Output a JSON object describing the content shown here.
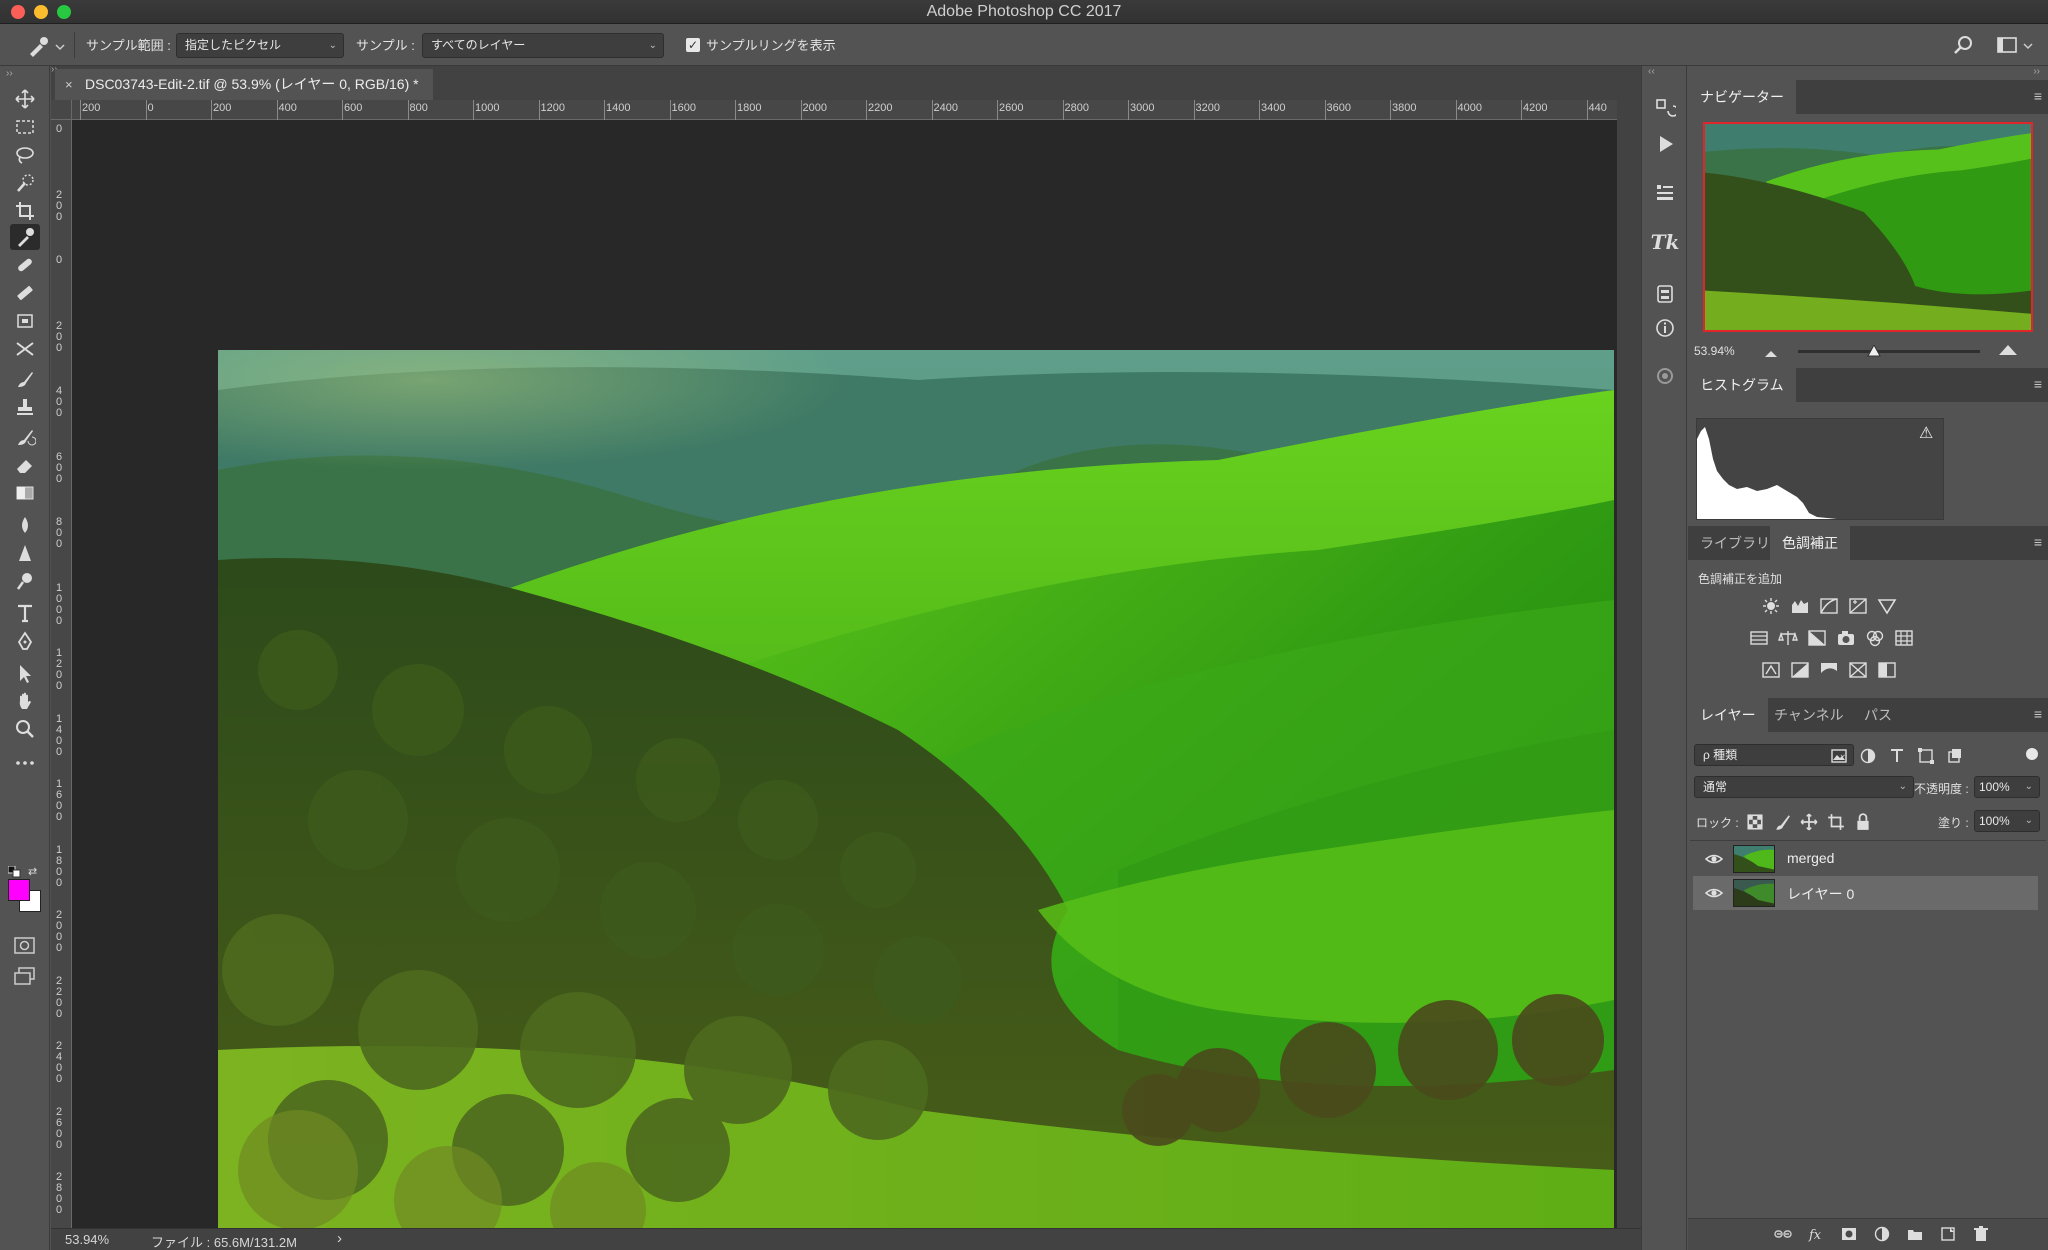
{
  "window": {
    "title": "Adobe Photoshop CC 2017"
  },
  "options": {
    "sample_size_label": "サンプル範囲 :",
    "sample_size_value": "指定したピクセル",
    "sample_label": "サンプル :",
    "sample_value": "すべてのレイヤー",
    "show_ring_label": "サンプルリングを表示",
    "show_ring_checked": true
  },
  "document": {
    "tab_title": "DSC03743-Edit-2.tif @ 53.9% (レイヤー 0, RGB/16) *",
    "close_glyph": "×",
    "ruler_h": [
      "200",
      "0",
      "200",
      "400",
      "600",
      "800",
      "1000",
      "1200",
      "1400",
      "1600",
      "1800",
      "2000",
      "2200",
      "2400",
      "2600",
      "2800",
      "3000",
      "3200",
      "3400",
      "3600",
      "3800",
      "4000",
      "4200",
      "440"
    ],
    "ruler_v": [
      "0",
      "2\n0\n0",
      "0",
      "2\n0\n0",
      "4\n0\n0",
      "6\n0\n0",
      "8\n0\n0",
      "1\n0\n0\n0",
      "1\n2\n0\n0",
      "1\n4\n0\n0",
      "1\n6\n0\n0",
      "1\n8\n0\n0",
      "2\n0\n0\n0",
      "2\n2\n0\n0",
      "2\n4\n0\n0",
      "2\n6\n0\n0",
      "2\n8\n0\n0"
    ]
  },
  "status": {
    "zoom": "53.94%",
    "file_info": "ファイル : 65.6M/131.2M",
    "more_glyph": "›"
  },
  "colors": {
    "foreground": "#ff00ff",
    "background": "#ffffff",
    "accent_selection": "#e0262a"
  },
  "navigator": {
    "tab": "ナビゲーター",
    "zoom": "53.94%",
    "zoom_fraction": 0.42
  },
  "histogram": {
    "tab": "ヒストグラム",
    "warning_glyph": "⚠"
  },
  "adjustments": {
    "tabs": [
      "ライブラリ",
      "色調補正"
    ],
    "active_tab": 1,
    "add_label": "色調補正を追加"
  },
  "layers_panel": {
    "tabs": [
      "レイヤー",
      "チャンネル",
      "パス"
    ],
    "filter_kind": "ρ 種類",
    "blend_mode": "通常",
    "opacity_label": "不透明度 :",
    "opacity_value": "100%",
    "lock_label": "ロック :",
    "fill_label": "塗り :",
    "fill_value": "100%",
    "layers": [
      {
        "name": "merged",
        "visible": true,
        "selected": false
      },
      {
        "name": "レイヤー 0",
        "visible": true,
        "selected": true
      }
    ],
    "footer_icons": [
      "link-icon",
      "fx-icon",
      "mask-icon",
      "adjustment-icon",
      "group-icon",
      "new-layer-icon",
      "trash-icon"
    ]
  },
  "tools": [
    "move-tool",
    "marquee-tool",
    "lasso-tool",
    "quick-select-tool",
    "crop-tool",
    "eyedropper-tool",
    "healing-brush-tool",
    "patch-tool",
    "content-aware-move-tool",
    "puppet-warp-tool",
    "brush-tool",
    "clone-stamp-tool",
    "history-brush-tool",
    "eraser-tool",
    "gradient-tool",
    "blur-tool",
    "sharpen-tool",
    "dodge-tool",
    "type-tool",
    "pen-tool",
    "path-select-tool",
    "hand-tool",
    "zoom-tool",
    "more-tools"
  ],
  "dock_icons": [
    "history-icon",
    "actions-play-icon",
    "tool-presets-icon",
    "tk-panel-icon",
    "properties-icon",
    "info-icon",
    "camera-raw-icon"
  ]
}
